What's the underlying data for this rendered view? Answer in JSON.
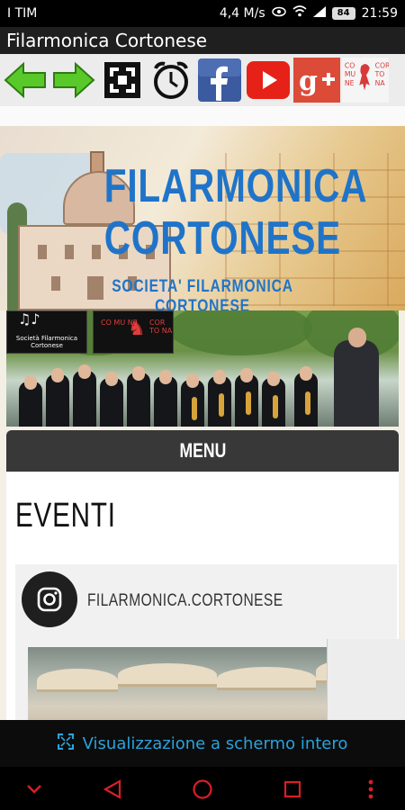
{
  "status_bar": {
    "carrier": "I TIM",
    "speed": "4,4 M/s",
    "battery": "84",
    "time": "21:59"
  },
  "app": {
    "title": "Filarmonica Cortonese"
  },
  "toolbar": {
    "items": [
      {
        "icon": "back-arrow-icon"
      },
      {
        "icon": "forward-arrow-icon"
      },
      {
        "icon": "fullscreen-icon"
      },
      {
        "icon": "alarm-clock-icon"
      },
      {
        "icon": "facebook-icon"
      },
      {
        "icon": "youtube-icon"
      },
      {
        "icon": "google-plus-icon"
      },
      {
        "icon": "comune-cortona-logo"
      }
    ]
  },
  "header": {
    "title": "FILARMONICA CORTONESE",
    "subtitle": "SOCIETA'  FILARMONICA  CORTONESE"
  },
  "banner": {
    "logo_left_text": "Società Filarmonica Cortonese",
    "logo_right_left": "CO MU NE",
    "logo_right_right": "COR TO NA"
  },
  "menu": {
    "label": "MENU"
  },
  "events": {
    "heading": "EVENTI",
    "instagram_user": "FILARMONICA.CORTONESE"
  },
  "fullscreen": {
    "label": "Visualizzazione a schermo intero"
  },
  "colors": {
    "accent_blue": "#1f74c9",
    "link_blue": "#29a3dd",
    "nav_red": "#d81f26",
    "arrow_green": "#59c92a"
  }
}
